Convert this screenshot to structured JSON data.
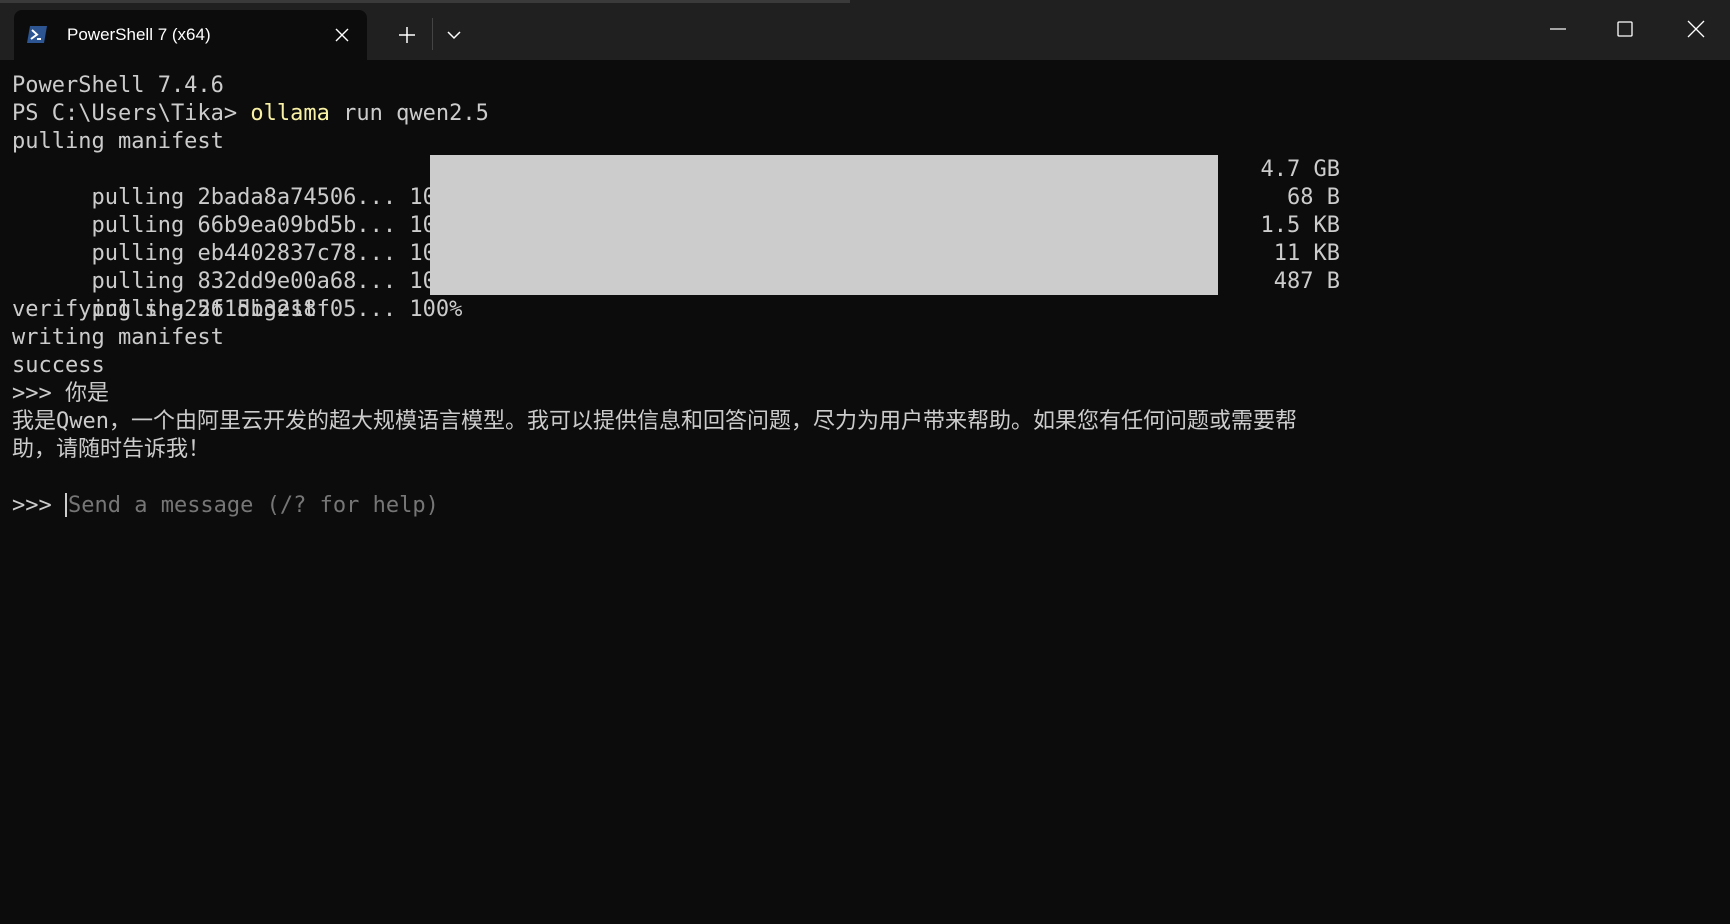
{
  "window": {
    "tab_title": "PowerShell 7 (x64)",
    "tab_icon": "powershell-icon",
    "new_tab_icon": "plus-icon",
    "dropdown_icon": "chevron-down-icon",
    "minimize_icon": "minimize-icon",
    "maximize_icon": "maximize-icon",
    "close_icon": "close-icon"
  },
  "colors": {
    "background": "#0c0c0c",
    "titlebar": "#202020",
    "text": "#cccccc",
    "command": "#f9f1a5",
    "placeholder": "#767676",
    "progress_fill": "#cccccc"
  },
  "terminal": {
    "version_line": "PowerShell 7.4.6",
    "prompt": "PS C:\\Users\\Tika> ",
    "command_name": "ollama",
    "command_args": " run qwen2.5",
    "pulling_manifest": "pulling manifest",
    "layers": [
      {
        "text": "pulling 2bada8a74506... 100% ",
        "size": "4.7 GB",
        "progress": 1.0
      },
      {
        "text": "pulling 66b9ea09bd5b... 100% ",
        "size": "68 B",
        "progress": 1.0
      },
      {
        "text": "pulling eb4402837c78... 100% ",
        "size": "1.5 KB",
        "progress": 1.0
      },
      {
        "text": "pulling 832dd9e00a68... 100% ",
        "size": "11 KB",
        "progress": 1.0
      },
      {
        "text": "pulling 2f15b3218f05... 100% ",
        "size": "487 B",
        "progress": 1.0
      }
    ],
    "verifying": "verifying sha256 digest",
    "writing": "writing manifest",
    "success": "success",
    "user_prompt": ">>> 你是",
    "response_line1": "我是Qwen，一个由阿里云开发的超大规模语言模型。我可以提供信息和回答问题，尽力为用户带来帮助。如果您有任何问题或需要帮",
    "response_line2": "助，请随时告诉我！",
    "input_prompt": ">>> ",
    "input_placeholder": "Send a message (/? for help)"
  }
}
